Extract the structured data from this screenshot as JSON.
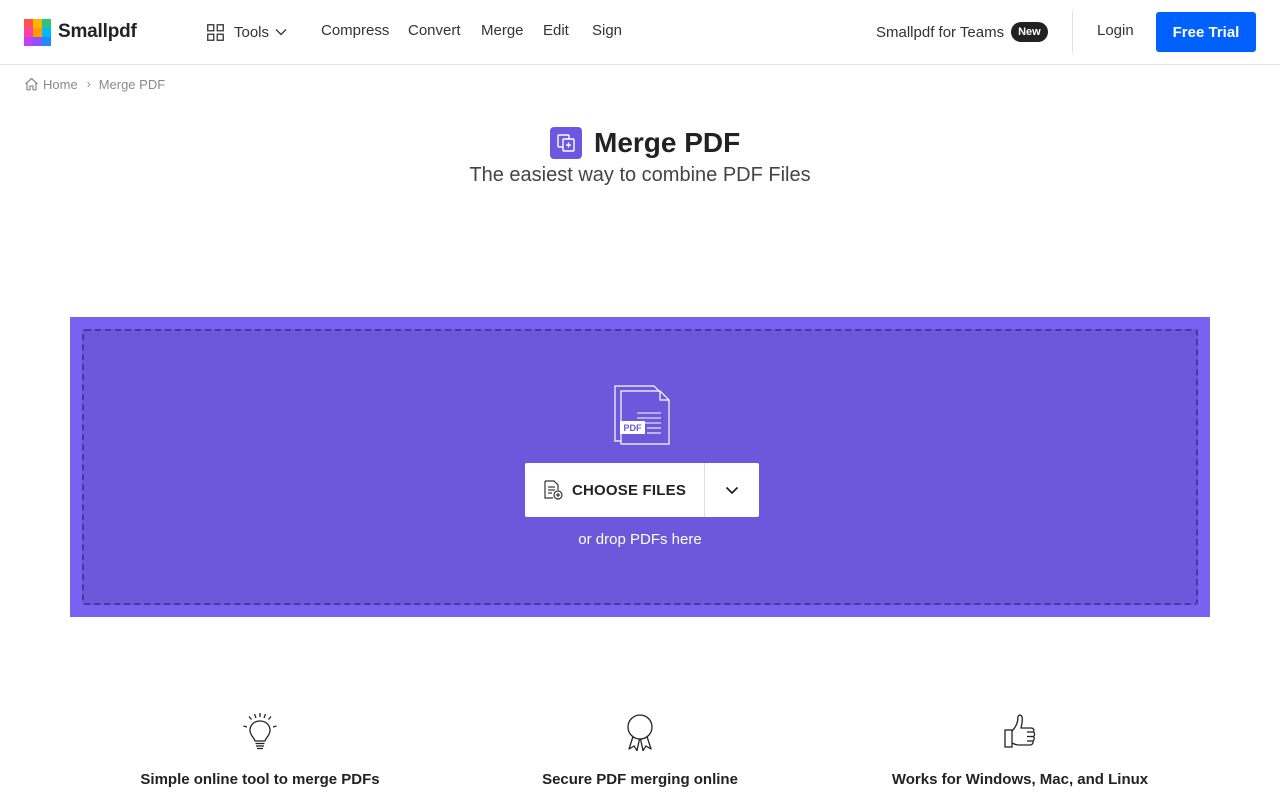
{
  "header": {
    "brand": "Smallpdf",
    "tools_label": "Tools",
    "nav": [
      "Compress",
      "Convert",
      "Merge",
      "Edit",
      "Sign"
    ],
    "teams_label": "Smallpdf for Teams",
    "teams_badge": "New",
    "login_label": "Login",
    "free_trial_label": "Free Trial"
  },
  "breadcrumb": {
    "home": "Home",
    "separator": "›",
    "current": "Merge PDF"
  },
  "page": {
    "title": "Merge PDF",
    "subtitle": "The easiest way to combine PDF Files"
  },
  "dropzone": {
    "illustration_badge": "PDF",
    "choose_label": "CHOOSE FILES",
    "drop_hint": "or drop PDFs here"
  },
  "features": [
    {
      "icon": "lightbulb-icon",
      "title": "Simple online tool to merge PDFs"
    },
    {
      "icon": "award-ribbon-icon",
      "title": "Secure PDF merging online"
    },
    {
      "icon": "thumbs-up-icon",
      "title": "Works for Windows, Mac, and Linux"
    }
  ],
  "colors": {
    "brand_blue": "#0061fe",
    "merge_purple": "#6d57db",
    "merge_purple_light": "#7961f2",
    "badge_dark": "#222222"
  },
  "logo_colors": [
    "#ff5151",
    "#ffb400",
    "#2ec27e",
    "#ff3fa4",
    "#ff9a00",
    "#00b8ff",
    "#c13fff",
    "#8c52ff",
    "#1e8bff"
  ]
}
